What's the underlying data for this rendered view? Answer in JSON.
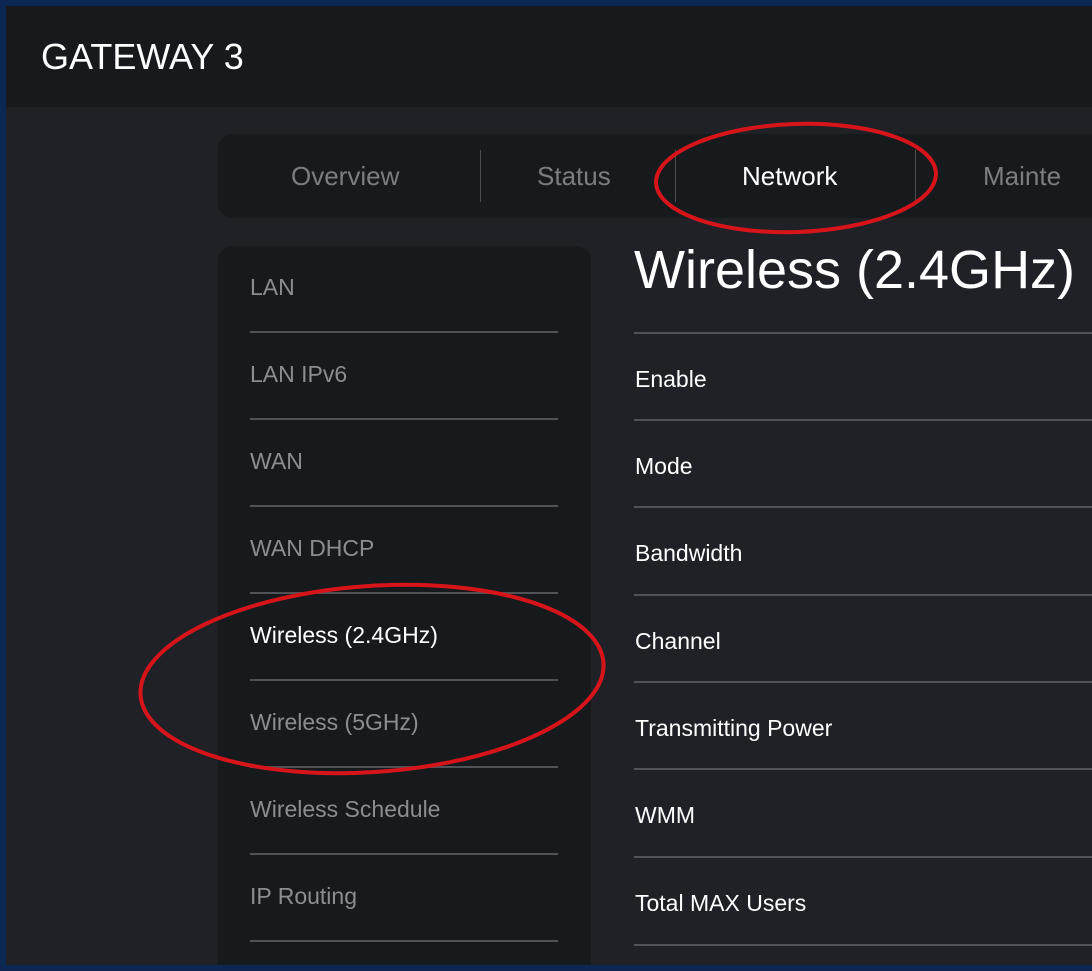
{
  "header": {
    "brand": "GATEWAY 3"
  },
  "tabs": [
    {
      "label": "Overview",
      "active": false
    },
    {
      "label": "Status",
      "active": false
    },
    {
      "label": "Network",
      "active": true
    },
    {
      "label": "Mainte",
      "active": false
    }
  ],
  "sidebar": {
    "items": [
      {
        "label": "LAN",
        "active": false
      },
      {
        "label": "LAN IPv6",
        "active": false
      },
      {
        "label": "WAN",
        "active": false
      },
      {
        "label": "WAN DHCP",
        "active": false
      },
      {
        "label": "Wireless (2.4GHz)",
        "active": true
      },
      {
        "label": "Wireless (5GHz)",
        "active": false
      },
      {
        "label": "Wireless Schedule",
        "active": false
      },
      {
        "label": "IP Routing",
        "active": false
      }
    ]
  },
  "main": {
    "title": "Wireless (2.4GHz)",
    "rows": [
      {
        "label": "Enable"
      },
      {
        "label": "Mode"
      },
      {
        "label": "Bandwidth"
      },
      {
        "label": "Channel"
      },
      {
        "label": "Transmitting Power"
      },
      {
        "label": "WMM"
      },
      {
        "label": "Total MAX Users"
      }
    ]
  },
  "colors": {
    "annotation": "#d8141b",
    "page_bg": "#1f2126",
    "panel_bg": "#171a1d",
    "border": "#0d2753"
  }
}
